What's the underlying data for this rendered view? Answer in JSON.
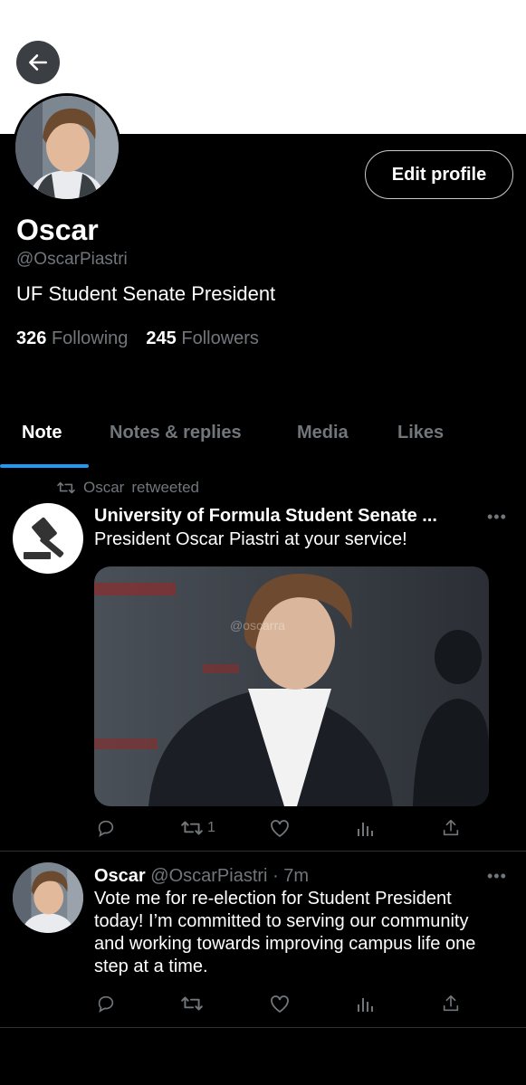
{
  "profile": {
    "name": "Oscar",
    "handle": "@OscarPiastri",
    "bio": "UF Student Senate President",
    "following_count": "326",
    "following_label": "Following",
    "followers_count": "245",
    "followers_label": "Followers",
    "edit_label": "Edit profile"
  },
  "tabs": [
    {
      "label": "Note",
      "active": true
    },
    {
      "label": "Notes & replies",
      "active": false
    },
    {
      "label": "Media",
      "active": false
    },
    {
      "label": "Likes",
      "active": false
    }
  ],
  "posts": [
    {
      "retweeted_by": "Oscar",
      "retweeted_label": "retweeted",
      "author": "University of Formula Student Senate ...",
      "text": "President Oscar Piastri at your service!",
      "media_watermark": "@oscarra",
      "retweets": "1"
    },
    {
      "author": "Oscar",
      "handle": "@OscarPiastri",
      "time": "· 7m",
      "text": "Vote me for re-election for Student President today! I’m committed to serving our community and working towards improving campus life one step at a time."
    }
  ],
  "icons": [
    "arrow-left-icon",
    "retweet-icon",
    "more-icon",
    "reply-icon",
    "like-icon",
    "views-icon",
    "share-icon",
    "gavel-icon"
  ],
  "colors": {
    "accent": "#1d9bf0",
    "muted": "#71767b",
    "divider": "#2f3336"
  }
}
